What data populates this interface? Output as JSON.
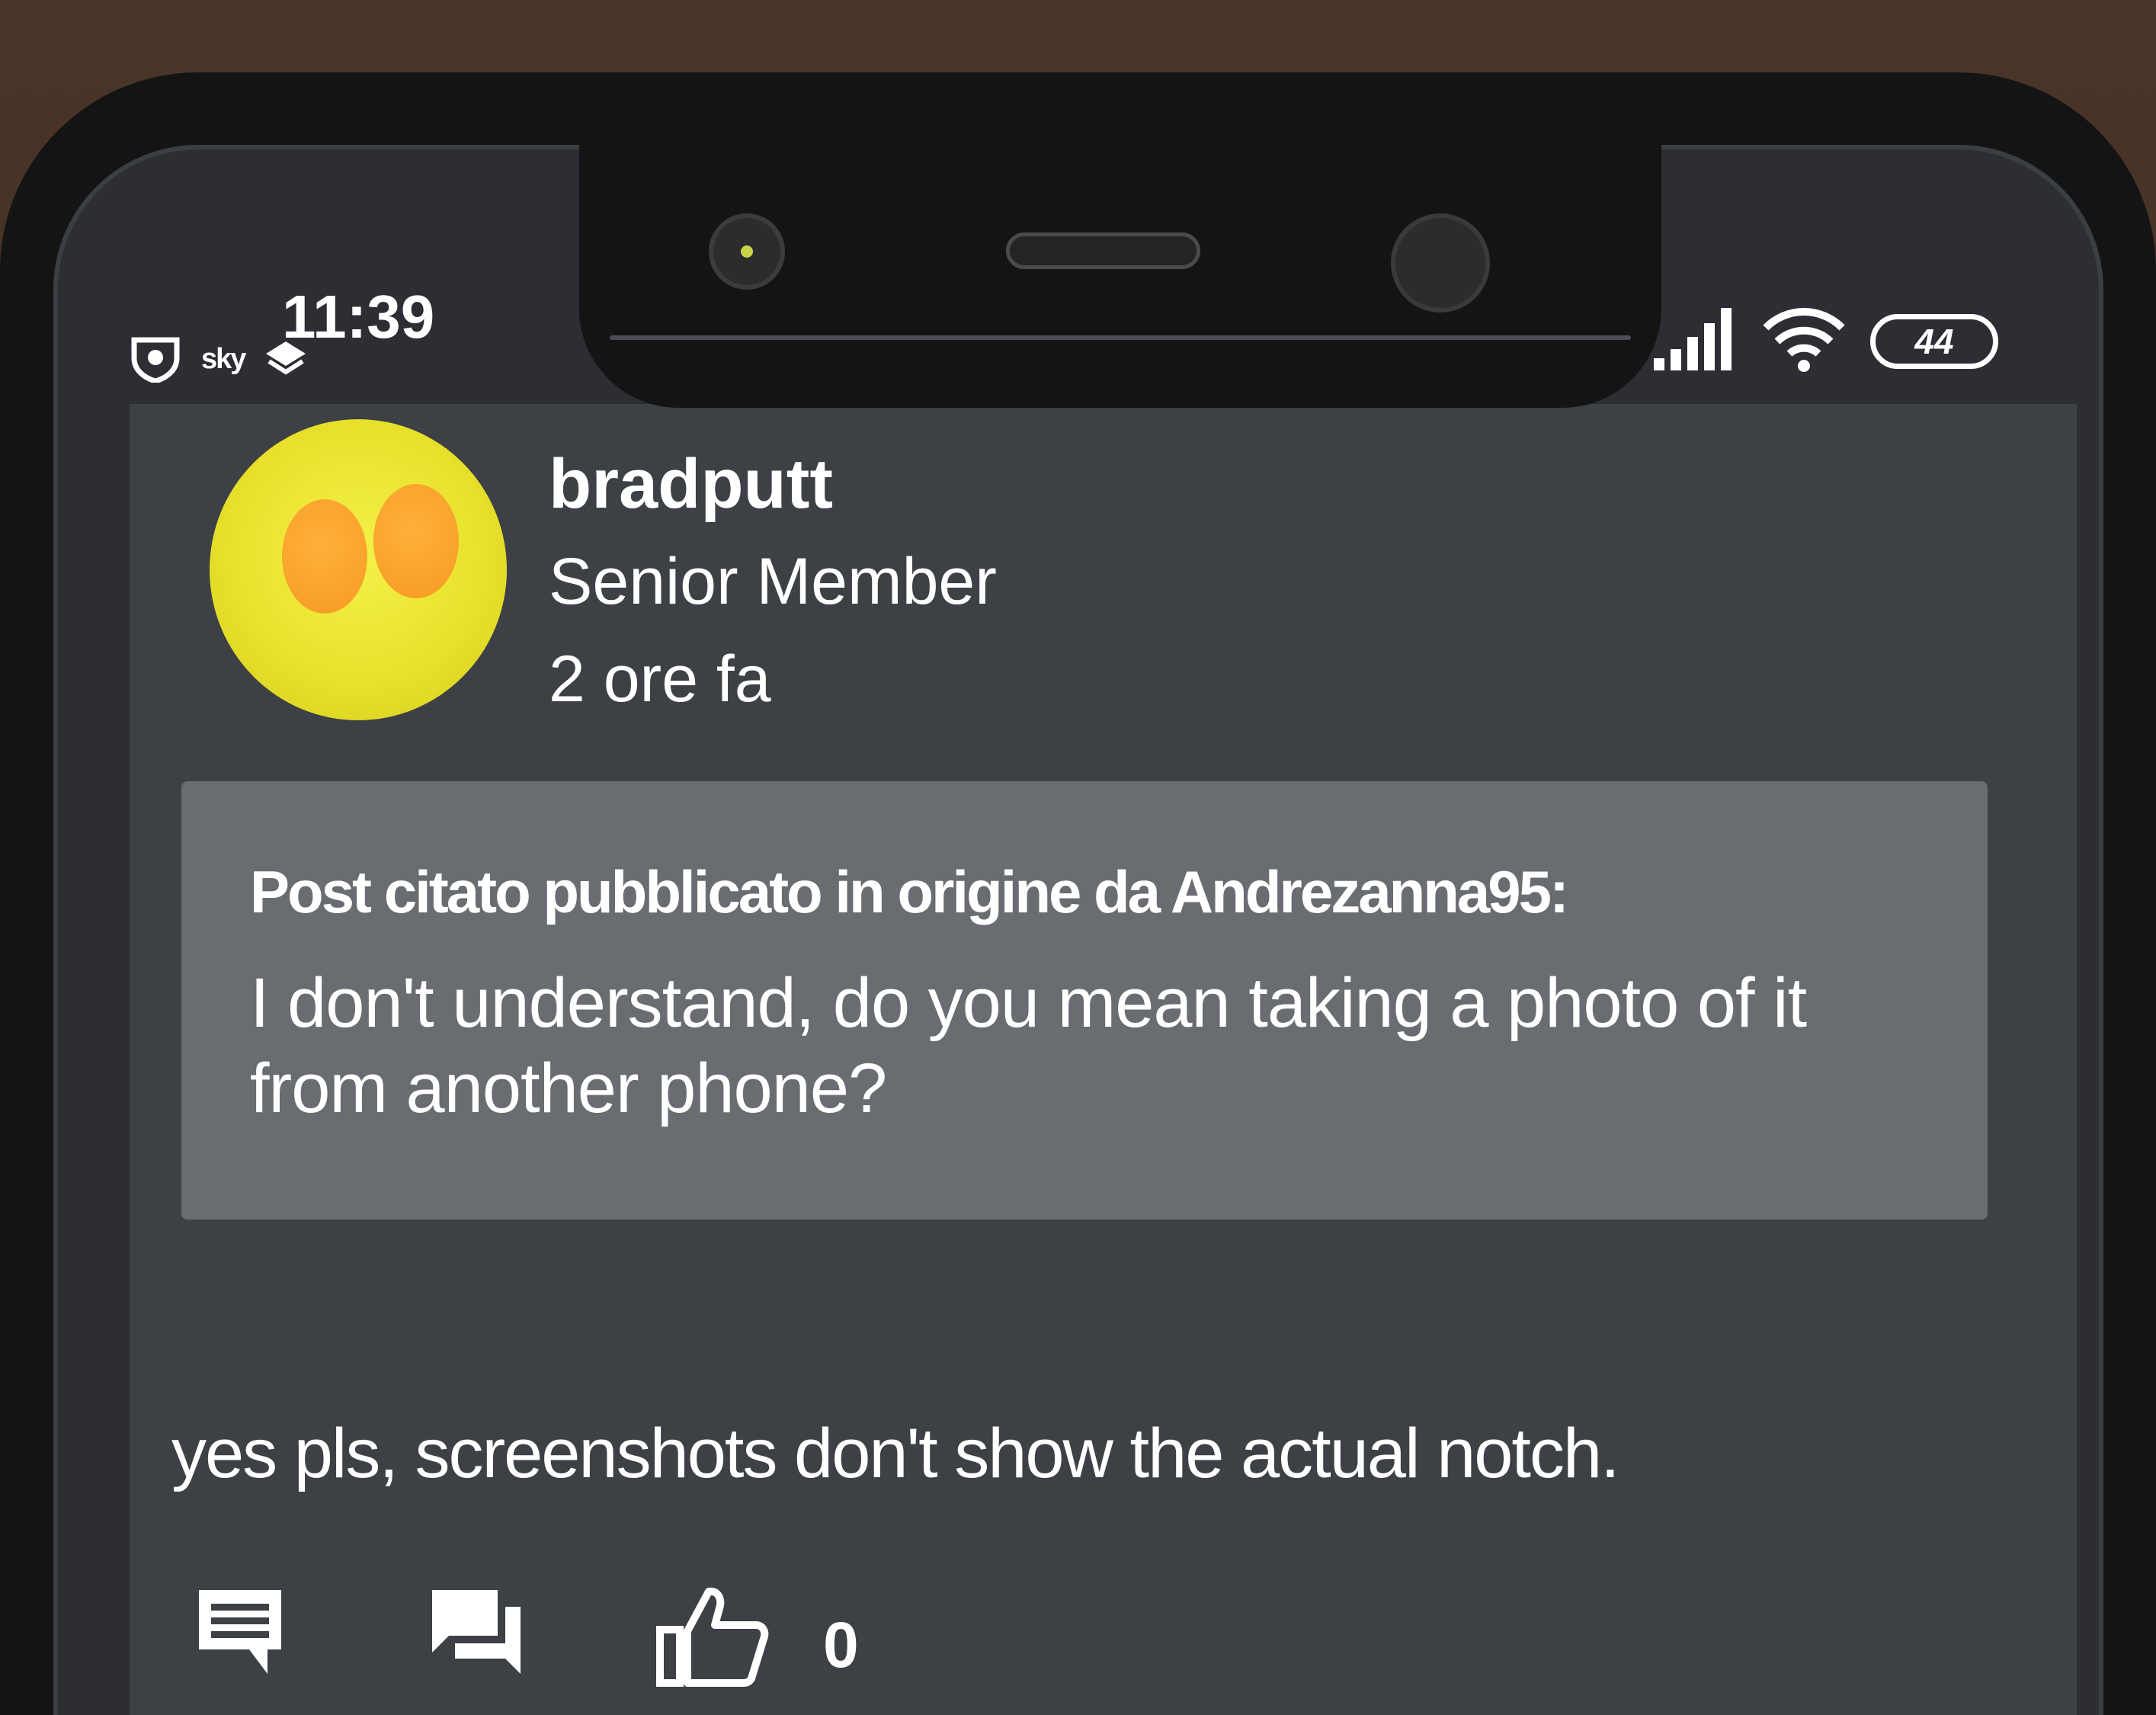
{
  "status_bar": {
    "time": "11:39",
    "sky_logo": "sky",
    "battery": "44"
  },
  "post": {
    "author": {
      "username": "bradputt",
      "role": "Senior Member"
    },
    "timestamp": "2 ore fa",
    "quote": {
      "attribution": "Post citato pubblicato in origine da Andrezanna95:",
      "text": "I don't understand, do you mean taking a photo of it from another phone?"
    },
    "reply": "yes pls, screenshots don't show the actual notch.",
    "actions": {
      "comment_icon": "comment-icon",
      "reply_icon": "reply-chat-icon",
      "like_icon": "thumbs-up-icon",
      "like_count": "0"
    }
  },
  "colors": {
    "app_background": "#3d4045",
    "quote_background": "#696c71",
    "text": "#ffffff",
    "avatar_yellow": "#e8e12b",
    "avatar_yolk": "#f59a22"
  }
}
